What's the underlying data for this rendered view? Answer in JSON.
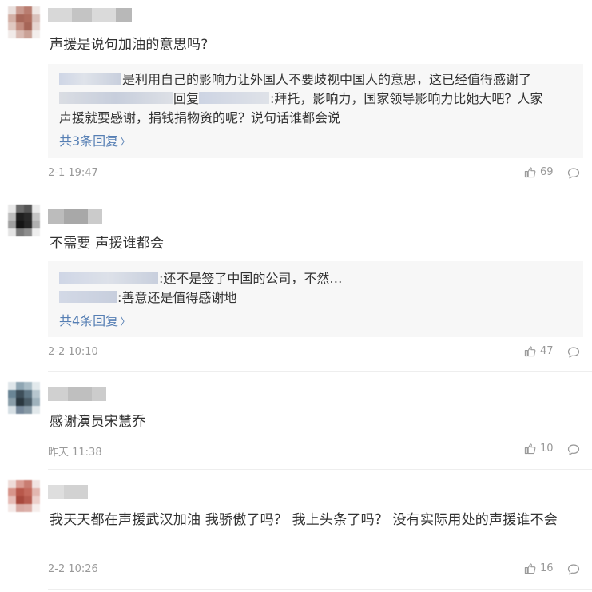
{
  "comments": [
    {
      "text": "声援是说句加油的意思吗?",
      "replies": [
        {
          "text": "是利用自己的影响力让外国人不要歧视中国人的意思，这已经值得感谢了"
        },
        {
          "reply_word": "回复",
          "text1": ":拜托，影响力，国家领导影响力比她大吧？人家",
          "text2": "声援就要感谢，捐钱捐物资的呢？说句话谁都会说"
        }
      ],
      "more": "共3条回复",
      "time": "2-1 19:47",
      "likes": "69"
    },
    {
      "text": "不需要 声援谁都会",
      "replies": [
        {
          "text": ":还不是签了中国的公司，不然…"
        },
        {
          "text": ":善意还是值得感谢地"
        }
      ],
      "more": "共4条回复",
      "time": "2-2 10:10",
      "likes": "47"
    },
    {
      "text": "感谢演员宋慧乔",
      "time": "昨天 11:38",
      "likes": "10"
    },
    {
      "text": "我天天都在声援武汉加油 我骄傲了吗？ 我上头条了吗？ 没有实际用处的声援谁不会",
      "time": "2-2 10:26",
      "likes": "16"
    }
  ],
  "icons": {
    "like": "thumbs-up-icon",
    "reply": "comment-bubble-icon",
    "more": "chevron-right-icon"
  },
  "colors": {
    "link": "#567fb4",
    "meta": "#999999",
    "reply_bg": "#f7f7f7"
  }
}
